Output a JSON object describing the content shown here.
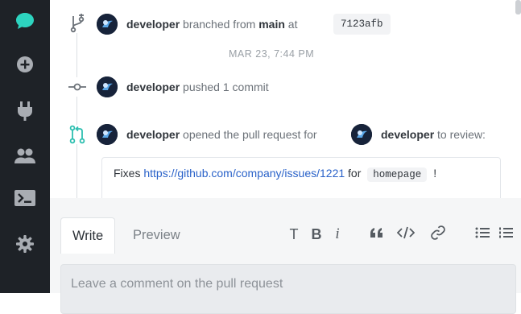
{
  "sidebar": {
    "items": [
      {
        "icon": "chat-bubble-icon",
        "active": true
      },
      {
        "icon": "plus-circle-icon"
      },
      {
        "icon": "plug-icon"
      },
      {
        "icon": "users-icon"
      },
      {
        "icon": "terminal-icon"
      },
      {
        "icon": "gear-icon"
      }
    ],
    "accent_color": "#2dd4bf"
  },
  "timeline": {
    "branch_event": {
      "user": "developer",
      "action": "branched from",
      "branch": "main",
      "at": "at",
      "commit": "7123afb"
    },
    "timestamp": "MAR 23, 7:44 PM",
    "push_event": {
      "user": "developer",
      "action": "pushed 1 commit"
    },
    "pr_event": {
      "user": "developer",
      "action": "opened the pull request for",
      "reviewer": "developer",
      "suffix": "to review:"
    },
    "description": {
      "prefix": "Fixes",
      "link": "https://github.com/company/issues/1221",
      "middle": "for",
      "code": "homepage",
      "suffix": "!"
    }
  },
  "composer": {
    "tabs": {
      "write": "Write",
      "preview": "Preview"
    },
    "toolbar": {
      "heading": "T",
      "bold": "B",
      "italic": "i"
    },
    "placeholder": "Leave a comment on the pull request"
  }
}
